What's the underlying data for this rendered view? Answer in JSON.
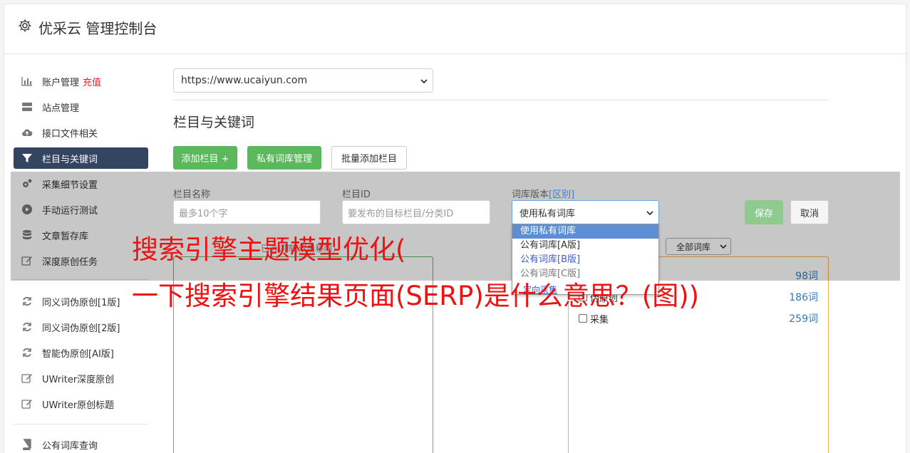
{
  "app": {
    "title": "优采云 管理控制台"
  },
  "sidebar": {
    "items": [
      {
        "label": "账户管理",
        "badge": "充值",
        "icon": "bar-chart-icon"
      },
      {
        "label": "站点管理",
        "icon": "server-icon"
      },
      {
        "label": "接口文件相关",
        "icon": "cloud-upload-icon"
      },
      {
        "label": "栏目与关键词",
        "icon": "filter-icon",
        "active": true
      },
      {
        "label": "采集细节设置",
        "icon": "gears-icon"
      },
      {
        "label": "手动运行测试",
        "icon": "play-circle-icon"
      },
      {
        "label": "文章暂存库",
        "icon": "database-icon"
      },
      {
        "label": "深度原创任务",
        "icon": "edit-icon"
      },
      {
        "label": "同义词伪原创[1版]",
        "icon": "refresh-icon"
      },
      {
        "label": "同义词伪原创[2版]",
        "icon": "refresh-icon"
      },
      {
        "label": "智能伪原创[AI版]",
        "icon": "refresh-icon"
      },
      {
        "label": "UWriter深度原创",
        "icon": "edit-icon"
      },
      {
        "label": "UWriter原创标题",
        "icon": "edit-icon"
      },
      {
        "label": "公有词库查询",
        "icon": "book-icon"
      }
    ]
  },
  "main": {
    "site_select": "https://www.ucaiyun.com",
    "section_title": "栏目与关键词",
    "buttons": {
      "add_column": "添加栏目 +",
      "private_lib": "私有词库管理",
      "batch_add": "批量添加栏目"
    },
    "form": {
      "column_name_label": "栏目名称",
      "column_name_placeholder": "最多10个字",
      "column_id_label": "栏目ID",
      "column_id_placeholder": "要发布的目标栏目/分类ID",
      "lib_version_label": "词库版本",
      "lib_version_hint": "[区别]",
      "lib_version_value": "使用私有词库",
      "save": "保存",
      "cancel": "取消"
    },
    "dropdown_options": [
      "使用私有词库",
      "公有词库[A版]",
      "公有词库[B版]",
      "公有词库[C版]"
    ],
    "fixed_link": "定向采集",
    "filter_hint": "已选词库(双击移除)",
    "lib_filter": "全部词库",
    "word_libs": [
      {
        "name": "",
        "count": "98词"
      },
      {
        "name": "伪原创",
        "count": "186词"
      },
      {
        "name": "采集",
        "count": "259词"
      }
    ]
  },
  "watermark": {
    "line1": "搜索引擎主题模型优化(",
    "line2": "一下搜索引擎结果页面(SERP)是什么意思？(图))"
  },
  "colors": {
    "active_nav": "#344561",
    "green": "#5cb85c",
    "recharge": "#e02020",
    "watermark": "#ee1111"
  }
}
